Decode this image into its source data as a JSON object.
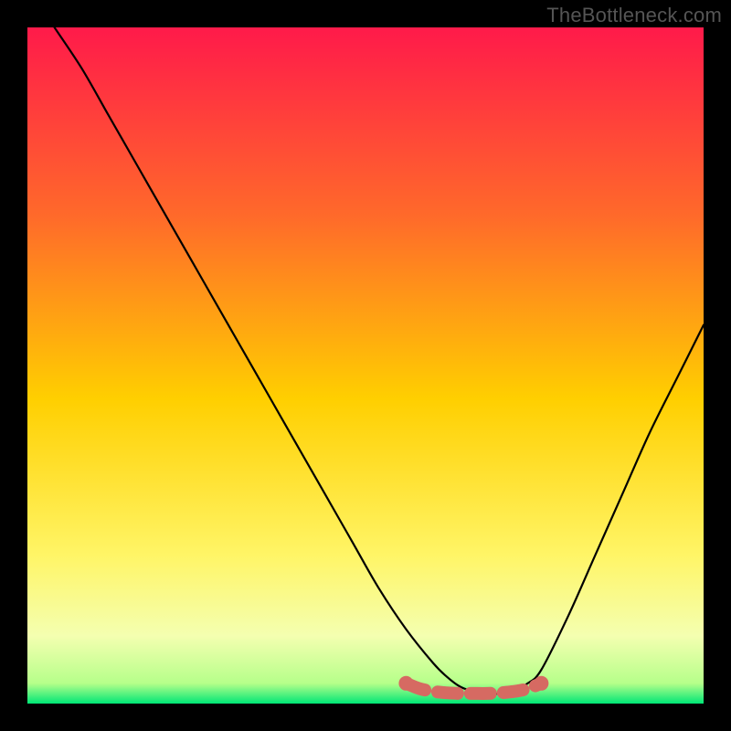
{
  "watermark": "TheBottleneck.com",
  "colors": {
    "gradient_top": "#ff1a4a",
    "gradient_mid1": "#ff8a2a",
    "gradient_mid2": "#ffe600",
    "gradient_mid3": "#f6ff7a",
    "gradient_bottom": "#00e676",
    "curve": "#000000",
    "marker": "#d66a62"
  },
  "chart_data": {
    "type": "line",
    "title": "",
    "xlabel": "",
    "ylabel": "",
    "xlim": [
      0,
      100
    ],
    "ylim": [
      0,
      100
    ],
    "series": [
      {
        "name": "bottleneck-curve",
        "x": [
          4,
          8,
          12,
          16,
          20,
          24,
          28,
          32,
          36,
          40,
          44,
          48,
          52,
          56,
          60,
          62,
          64,
          66,
          68,
          70,
          72,
          74,
          76,
          80,
          84,
          88,
          92,
          96,
          100
        ],
        "values": [
          100,
          94,
          87,
          80,
          73,
          66,
          59,
          52,
          45,
          38,
          31,
          24,
          17,
          11,
          6,
          4,
          2.5,
          1.8,
          1.5,
          1.5,
          2,
          3,
          5,
          13,
          22,
          31,
          40,
          48,
          56
        ]
      }
    ],
    "markers": {
      "name": "highlight-band",
      "x": [
        56,
        58,
        60,
        62,
        64,
        66,
        68,
        70,
        72,
        74,
        76
      ],
      "values": [
        3.0,
        2.2,
        1.8,
        1.6,
        1.5,
        1.5,
        1.5,
        1.6,
        1.8,
        2.2,
        3.0
      ]
    }
  }
}
